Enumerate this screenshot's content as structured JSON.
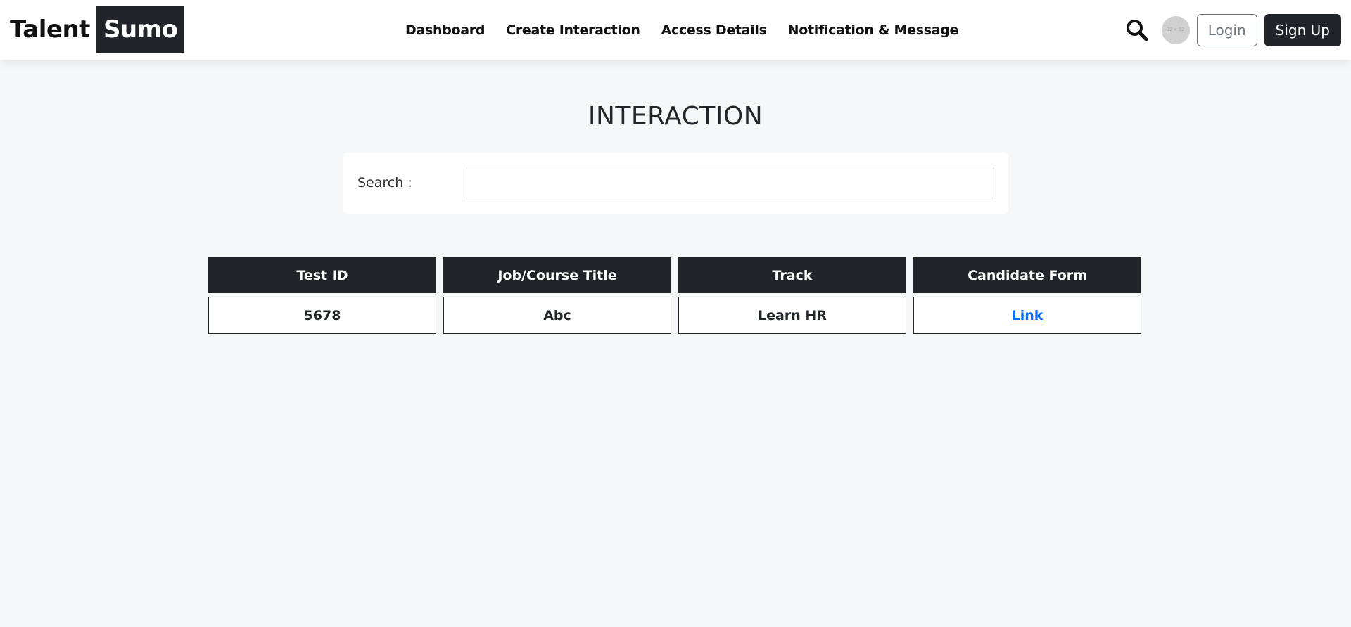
{
  "brand": {
    "part1": "Talent",
    "part2": "Sumo"
  },
  "nav": {
    "links": [
      "Dashboard",
      "Create Interaction",
      "Access Details",
      "Notification & Message"
    ],
    "avatar_text": "32 × 32",
    "login_label": "Login",
    "signup_label": "Sign Up"
  },
  "main": {
    "title": "INTERACTION",
    "search_label": "Search :",
    "search_value": ""
  },
  "table": {
    "headers": [
      "Test ID",
      "Job/Course Title",
      "Track",
      "Candidate Form"
    ],
    "rows": [
      {
        "test_id": "5678",
        "title": "Abc",
        "track": "Learn HR",
        "form_link": "Link"
      }
    ]
  },
  "colors": {
    "dark": "#212529",
    "link": "#0d6efd",
    "page_bg": "#f6f7f9"
  }
}
